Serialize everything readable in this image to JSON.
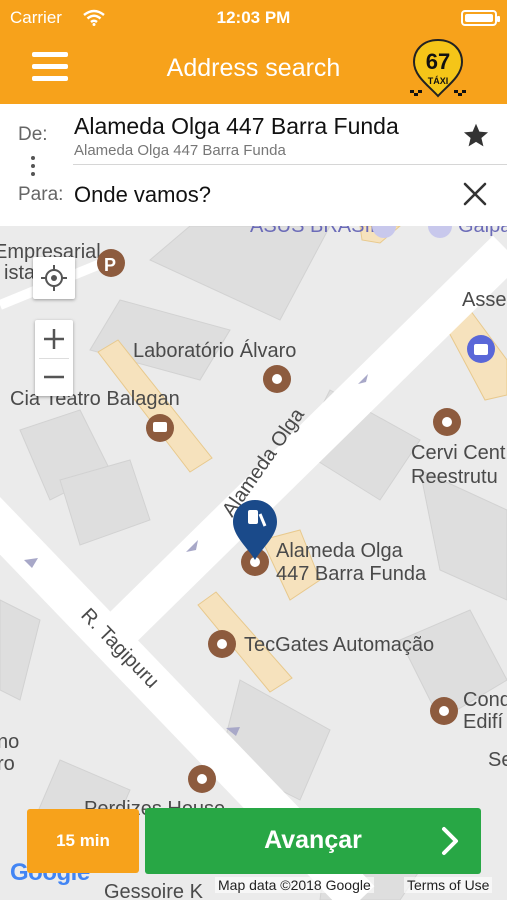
{
  "status_bar": {
    "carrier": "Carrier",
    "time": "12:03 PM"
  },
  "header": {
    "title": "Address search",
    "logo_number": "67",
    "logo_word": "TÁXI",
    "menu_icon": "hamburger-menu-icon"
  },
  "address": {
    "from_label": "De:",
    "from_value": "Alameda Olga 447 Barra Funda",
    "from_sub": "Alameda Olga 447 Barra Funda",
    "to_label": "Para:",
    "to_placeholder": "Onde vamos?"
  },
  "map": {
    "streets": [
      "Alameda Olga",
      "R. Tagipuru"
    ],
    "places": [
      "Laboratório Álvaro",
      "Cia Teatro Balagan",
      "TecGates Automação",
      "Alameda Olga",
      "447 Barra Funda",
      "Cervi Cent",
      "Reestrutu",
      "Empresarial",
      "ista",
      "ASUS BRASIL",
      "Assess",
      "Galpa",
      "Cond",
      "Edifí",
      "Se",
      "no",
      "ro",
      "Perdizes House",
      "Gessoire K"
    ],
    "attribution": "Map data ©2018 Google",
    "terms": "Terms of Use",
    "google_logo": "Google"
  },
  "bottom": {
    "eta": "15 min",
    "next_label": "Avançar"
  },
  "colors": {
    "brand_orange": "#f7a21b",
    "action_green": "#28a745",
    "pin_blue": "#1a4a8a",
    "poi_brown": "#8d5b3e"
  }
}
